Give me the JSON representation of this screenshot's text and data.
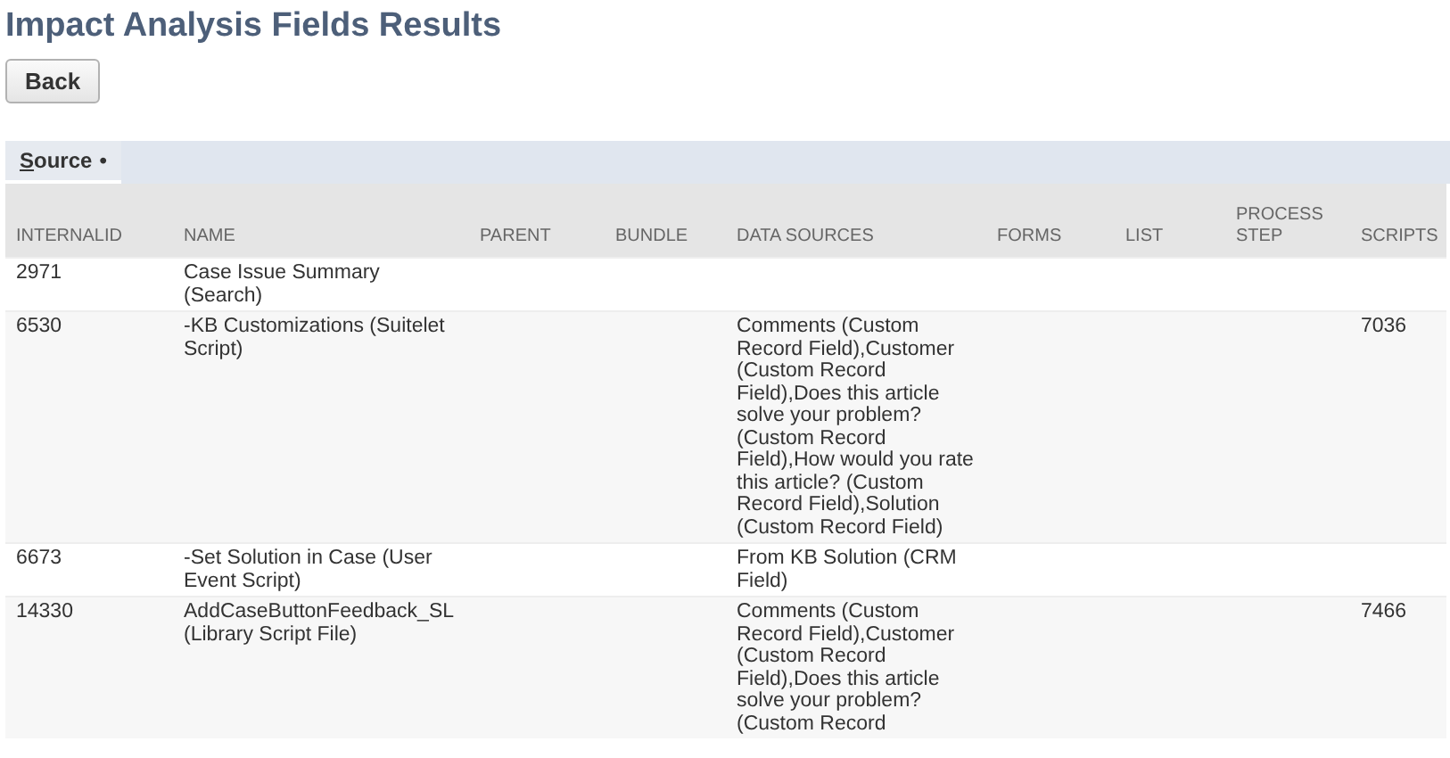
{
  "title": "Impact Analysis Fields Results",
  "back_button": "Back",
  "tabs": [
    {
      "label": "Source",
      "marker": "•",
      "selected": true
    }
  ],
  "table": {
    "columns": [
      "INTERNALID",
      "NAME",
      "PARENT",
      "BUNDLE",
      "DATA SOURCES",
      "FORMS",
      "LIST",
      "PROCESS STEP",
      "SCRIPTS"
    ],
    "rows": [
      {
        "cells": [
          "2971",
          "Case Issue Summary (Search)",
          "",
          "",
          "",
          "",
          "",
          "",
          ""
        ]
      },
      {
        "cells": [
          "6530",
          "-KB Customizations (Suitelet Script)",
          "",
          "",
          "Comments (Custom Record Field),Customer (Custom Record Field),Does this article solve your problem? (Custom Record Field),How would you rate this article? (Custom Record Field),Solution (Custom Record Field)",
          "",
          "",
          "",
          "7036"
        ]
      },
      {
        "cells": [
          "6673",
          "-Set Solution in Case (User Event Script)",
          "",
          "",
          "From KB Solution (CRM Field)",
          "",
          "",
          "",
          ""
        ]
      },
      {
        "cells": [
          "14330",
          "AddCaseButtonFeedback_SL (Library Script File)",
          "",
          "",
          "Comments (Custom Record Field),Customer (Custom Record Field),Does this article solve your problem? (Custom Record",
          "",
          "",
          "",
          "7466"
        ]
      }
    ]
  }
}
